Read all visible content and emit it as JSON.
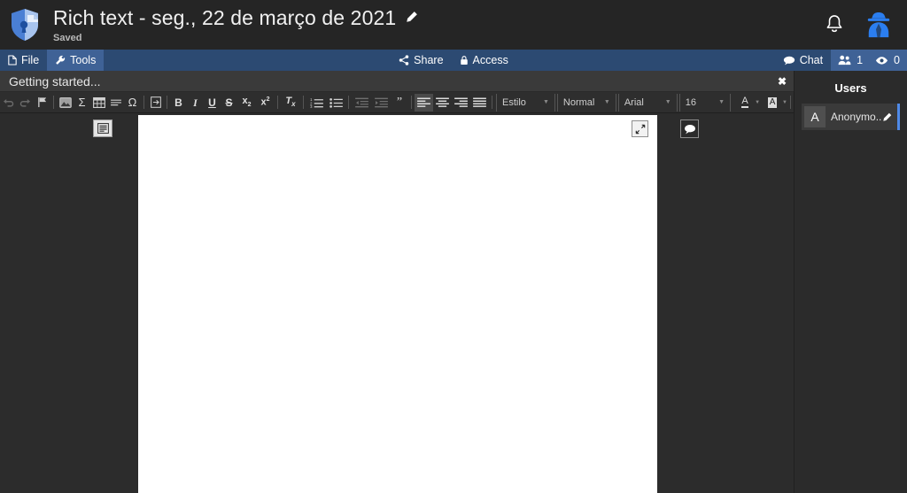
{
  "topbar": {
    "logo_icon": "shield-keyhole-icon",
    "doc_title": "Rich text - seg., 22 de março de 2021",
    "rename_icon": "pencil-icon",
    "save_status": "Saved",
    "notification_icon": "bell-icon",
    "account_icon": "incognito-user-icon"
  },
  "menubar": {
    "file": {
      "label": "File",
      "icon": "file-icon"
    },
    "tools": {
      "label": "Tools",
      "icon": "wrench-icon"
    },
    "share": {
      "label": "Share",
      "icon": "share-nodes-icon"
    },
    "access": {
      "label": "Access",
      "icon": "lock-icon"
    },
    "chat": {
      "label": "Chat",
      "icon": "chat-bubble-icon"
    },
    "users_icon": "users-group-icon",
    "users_count": "1",
    "viewers_icon": "eye-icon",
    "viewers_count": "0"
  },
  "notification": {
    "text": "Getting started...",
    "close_label": "✖"
  },
  "toolbar": {
    "groups": [
      {
        "name": "history-insert",
        "buttons": [
          {
            "name": "undo-button",
            "icon": "undo-icon",
            "glyph": "↶",
            "disabled": true
          },
          {
            "name": "redo-button",
            "icon": "redo-icon",
            "glyph": "↷",
            "disabled": true
          },
          {
            "name": "anchor-button",
            "icon": "flag-icon",
            "glyph": "⚑",
            "disabled": false
          }
        ]
      },
      {
        "name": "objects",
        "buttons": [
          {
            "name": "insert-image-button",
            "icon": "image-icon",
            "glyph": "▣",
            "disabled": false
          },
          {
            "name": "insert-equation-button",
            "icon": "sigma-icon",
            "glyph": "Σ",
            "disabled": false
          },
          {
            "name": "insert-table-button",
            "icon": "table-icon",
            "glyph": "▦",
            "disabled": false
          },
          {
            "name": "horizontal-rule-button",
            "icon": "horizontal-rule-icon",
            "glyph": "━",
            "disabled": false
          },
          {
            "name": "special-character-button",
            "icon": "omega-icon",
            "glyph": "Ω",
            "disabled": false
          }
        ]
      },
      {
        "name": "pagebreak",
        "buttons": [
          {
            "name": "page-break-button",
            "icon": "page-break-icon",
            "glyph": "⎘",
            "disabled": false
          }
        ]
      },
      {
        "name": "text-style",
        "buttons": [
          {
            "name": "bold-button",
            "icon": "bold-icon",
            "glyph": "B",
            "disabled": false
          },
          {
            "name": "italic-button",
            "icon": "italic-icon",
            "glyph": "I",
            "disabled": false
          },
          {
            "name": "underline-button",
            "icon": "underline-icon",
            "glyph": "U",
            "disabled": false
          },
          {
            "name": "strikethrough-button",
            "icon": "strikethrough-icon",
            "glyph": "S",
            "disabled": false
          },
          {
            "name": "subscript-button",
            "icon": "subscript-icon",
            "glyph": "x₂",
            "disabled": false
          },
          {
            "name": "superscript-button",
            "icon": "superscript-icon",
            "glyph": "x²",
            "disabled": false
          }
        ]
      },
      {
        "name": "remove-format",
        "buttons": [
          {
            "name": "remove-format-button",
            "icon": "clear-formatting-icon",
            "glyph": "Tx",
            "disabled": false
          }
        ]
      },
      {
        "name": "lists",
        "buttons": [
          {
            "name": "numbered-list-button",
            "icon": "numbered-list-icon",
            "glyph": "≔",
            "disabled": false
          },
          {
            "name": "bulleted-list-button",
            "icon": "bulleted-list-icon",
            "glyph": "≔",
            "disabled": false
          }
        ]
      },
      {
        "name": "indent",
        "buttons": [
          {
            "name": "decrease-indent-button",
            "icon": "outdent-icon",
            "glyph": "⇤",
            "disabled": true
          },
          {
            "name": "increase-indent-button",
            "icon": "indent-icon",
            "glyph": "⇥",
            "disabled": true
          },
          {
            "name": "blockquote-button",
            "icon": "quote-icon",
            "glyph": "❞",
            "disabled": false
          }
        ]
      },
      {
        "name": "align",
        "buttons": [
          {
            "name": "align-left-button",
            "icon": "align-left-icon",
            "glyph": "≡",
            "disabled": false,
            "active": true
          },
          {
            "name": "align-center-button",
            "icon": "align-center-icon",
            "glyph": "≡",
            "disabled": false
          },
          {
            "name": "align-right-button",
            "icon": "align-right-icon",
            "glyph": "≡",
            "disabled": false
          },
          {
            "name": "align-justify-button",
            "icon": "align-justify-icon",
            "glyph": "≡",
            "disabled": false
          }
        ]
      }
    ],
    "style_select": "Estilo",
    "format_select": "Normal",
    "font_select": "Arial",
    "size_select": "16",
    "text_color_button": {
      "name": "text-color-button",
      "icon": "text-color-icon",
      "glyph": "A"
    },
    "background_color_button": {
      "name": "background-color-button",
      "icon": "background-color-icon",
      "glyph": "A"
    }
  },
  "editor": {
    "outline_toggle_icon": "outline-panel-icon",
    "expand_icon": "expand-arrows-icon",
    "comment_icon": "comment-bubble-icon",
    "page_content": ""
  },
  "users_panel": {
    "title": "Users",
    "users": [
      {
        "initial": "A",
        "name": "Anonymo...",
        "edit_icon": "pencil-icon"
      }
    ]
  },
  "colors": {
    "accent_blue": "#4f8ae8",
    "menubar_blue": "#2c4a72",
    "menubar_active": "#3f6296",
    "topbar_bg": "#252525",
    "body_bg": "#2c2c2c",
    "toolbar_bg": "#2e2e2e",
    "notif_bg": "#3a3a3a",
    "page_white": "#ffffff"
  }
}
